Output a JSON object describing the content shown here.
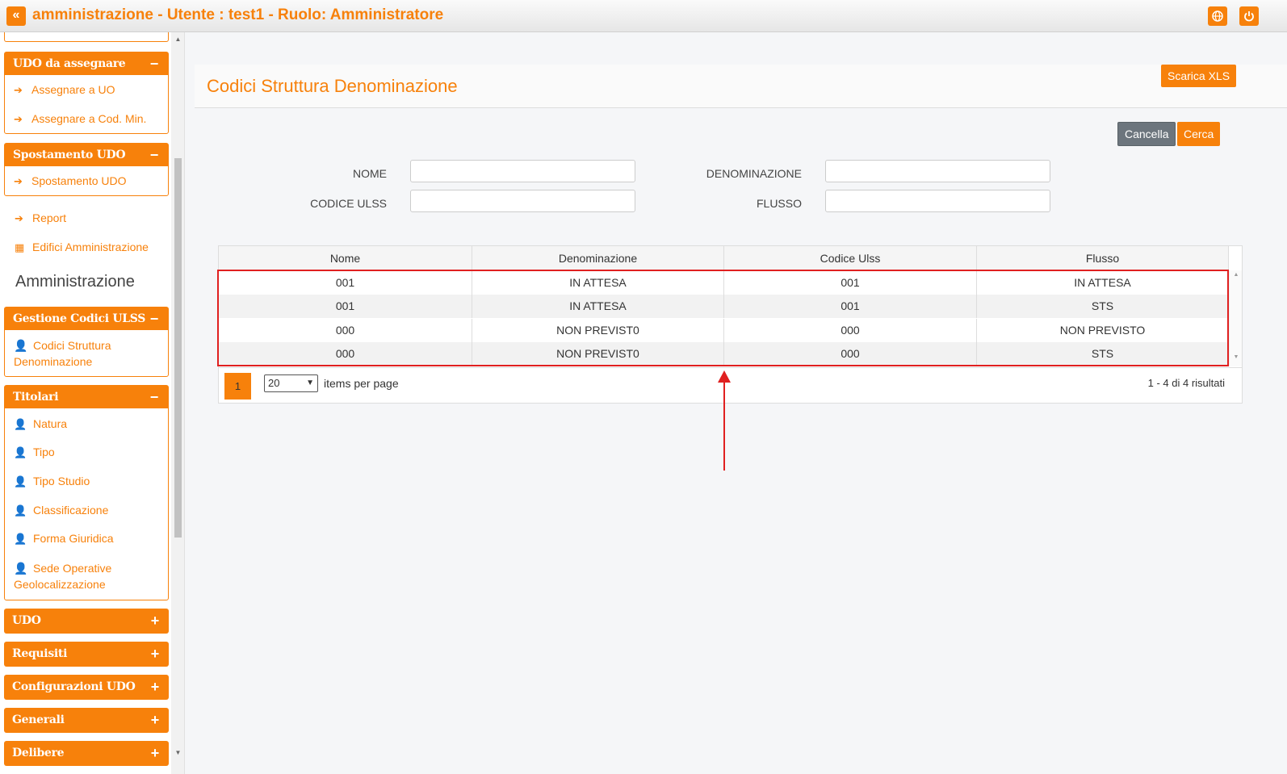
{
  "topbar": {
    "collapse_icon": "«",
    "title": "amministrazione - Utente : test1 - Ruolo: Amministratore",
    "globe_icon": "globe-icon",
    "power_icon": "power-icon"
  },
  "sidebar": {
    "udo_da_assegnare": {
      "title": "UDO da assegnare",
      "toggle": "−",
      "items": [
        "Assegnare a UO",
        "Assegnare a Cod. Min."
      ]
    },
    "spostamento": {
      "title": "Spostamento UDO",
      "toggle": "−",
      "items": [
        "Spostamento UDO"
      ]
    },
    "report": "Report",
    "edifici": "Edifici Amministrazione",
    "section_title": "Amministrazione",
    "gestione": {
      "title": "Gestione Codici ULSS",
      "toggle": "−",
      "items": [
        "Codici Struttura Denominazione"
      ]
    },
    "titolari": {
      "title": "Titolari",
      "toggle": "−",
      "items": [
        "Natura",
        "Tipo",
        "Tipo Studio",
        "Classificazione",
        "Forma Giuridica",
        "Sede Operative Geolocalizzazione"
      ]
    },
    "collapsed": [
      {
        "title": "UDO",
        "toggle": "+"
      },
      {
        "title": "Requisiti",
        "toggle": "+"
      },
      {
        "title": "Configurazioni UDO",
        "toggle": "+"
      },
      {
        "title": "Generali",
        "toggle": "+"
      },
      {
        "title": "Delibere",
        "toggle": "+"
      }
    ]
  },
  "main": {
    "page_title": "Codici Struttura Denominazione",
    "export_label": "Scarica XLS",
    "cancel_label": "Cancella",
    "search_label": "Cerca",
    "form": {
      "nome_label": "NOME",
      "denominazione_label": "DENOMINAZIONE",
      "codice_ulss_label": "CODICE ULSS",
      "flusso_label": "FLUSSO",
      "nome_value": "",
      "denominazione_value": "",
      "codice_ulss_value": "",
      "flusso_value": ""
    },
    "table": {
      "columns": [
        "Nome",
        "Denominazione",
        "Codice Ulss",
        "Flusso"
      ],
      "rows": [
        [
          "001",
          "IN ATTESA",
          "001",
          "IN ATTESA"
        ],
        [
          "001",
          "IN ATTESA",
          "001",
          "STS"
        ],
        [
          "000",
          "NON PREVIST0",
          "000",
          "NON PREVISTO"
        ],
        [
          "000",
          "NON PREVIST0",
          "000",
          "STS"
        ]
      ]
    },
    "pager": {
      "current_page": "1",
      "per_page": "20",
      "items_per_page_label": "items per page",
      "results": "1 - 4 di 4 risultati"
    }
  },
  "colors": {
    "accent": "#f7810b",
    "annotation": "#e02020"
  }
}
